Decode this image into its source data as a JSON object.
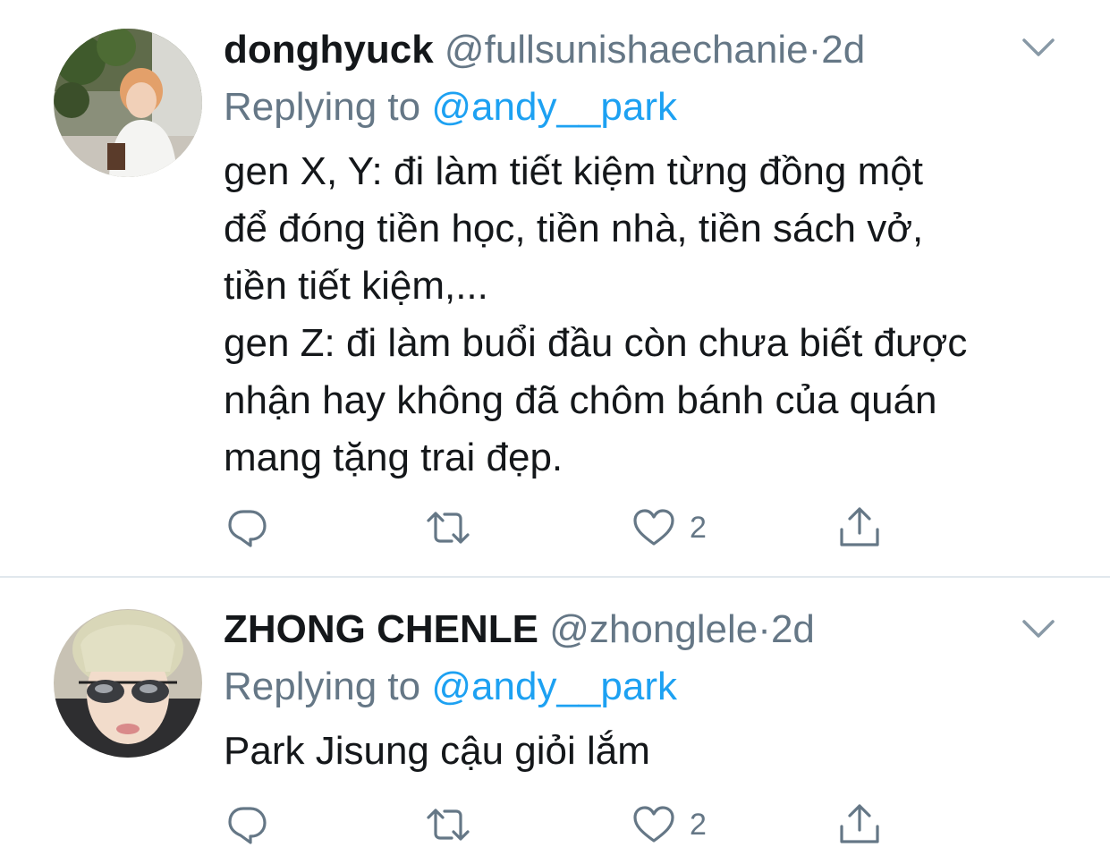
{
  "tweets": [
    {
      "name": "donghyuck",
      "handle": "@fullsunishaechanie",
      "dot": "·",
      "time": "2d",
      "replying_prefix": "Replying to",
      "replying_to": "@andy__park",
      "text_lines": [
        "gen X, Y: đi làm tiết kiệm từng đồng một",
        "để đóng tiền học, tiền nhà, tiền sách vở,",
        "tiền tiết kiệm,...",
        "gen Z: đi làm buổi đầu còn chưa biết được",
        "nhận hay không đã chôm bánh của quán",
        "mang tặng trai đẹp."
      ],
      "like_count": "2",
      "icons": [
        "reply-icon",
        "retweet-icon",
        "heart-icon",
        "share-icon",
        "chevron-down-icon"
      ]
    },
    {
      "name": "ZHONG CHENLE",
      "handle": "@zhonglele",
      "dot": "·",
      "time": "2d",
      "replying_prefix": "Replying to",
      "replying_to": "@andy__park",
      "text_lines": [
        "Park Jisung cậu giỏi lắm"
      ],
      "like_count": "2",
      "icons": [
        "reply-icon",
        "retweet-icon",
        "heart-icon",
        "share-icon",
        "chevron-down-icon"
      ]
    }
  ],
  "colors": {
    "link": "#1da1f2",
    "secondary_text": "#657786",
    "primary_text": "#14171a",
    "divider": "#e1e8ed"
  }
}
